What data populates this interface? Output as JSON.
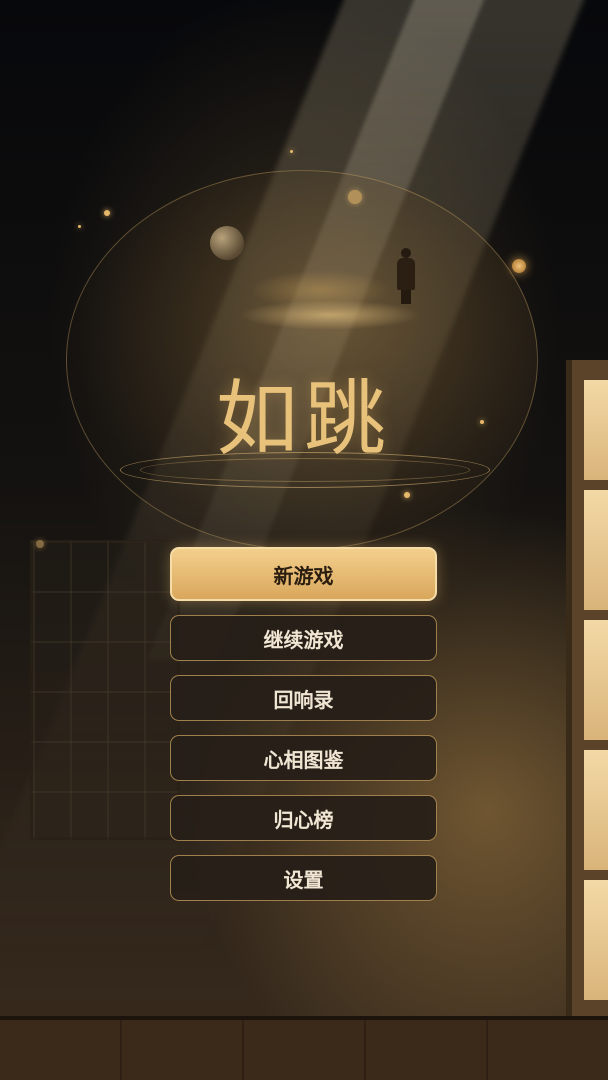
{
  "game": {
    "title": "如跳"
  },
  "menu": {
    "items": [
      {
        "label": "新游戏",
        "primary": true
      },
      {
        "label": "继续游戏"
      },
      {
        "label": "回响录"
      },
      {
        "label": "心相图鉴"
      },
      {
        "label": "归心榜"
      },
      {
        "label": "设置"
      }
    ]
  },
  "colors": {
    "accent_gold": "#e8c27a",
    "primary_button": "#e8bb72",
    "button_dark": "#261e18",
    "button_border": "#c8a05f"
  }
}
